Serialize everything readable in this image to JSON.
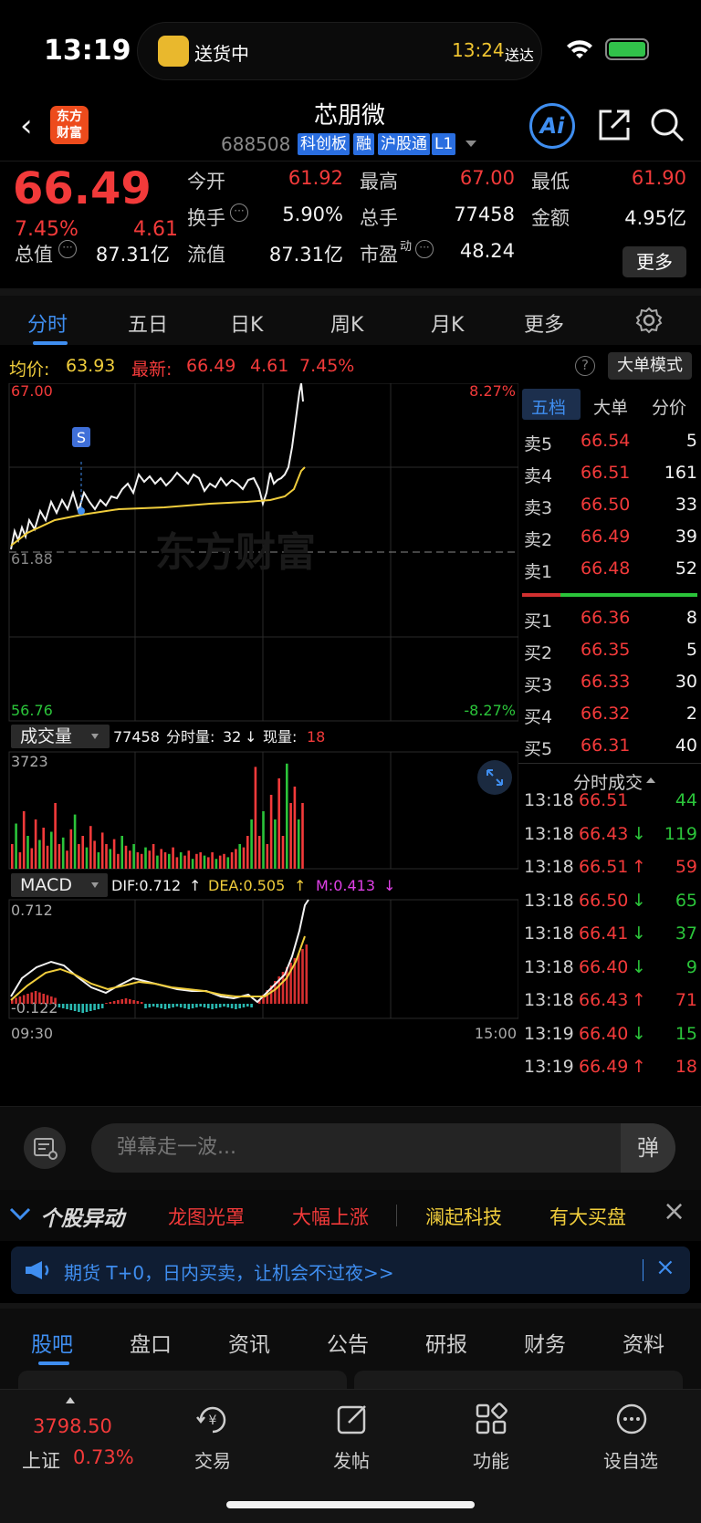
{
  "status": {
    "time": "13:19",
    "activity": "送货中",
    "eta_time": "13:24",
    "eta_label": "送达"
  },
  "header": {
    "back": "‹",
    "logo": "东方\n财富",
    "name": "芯朋微",
    "code": "688508",
    "tags": [
      "科创板",
      "融",
      "沪股通",
      "L1"
    ],
    "ai": "Ai"
  },
  "quote": {
    "price": "66.49",
    "change_pct": "7.45%",
    "change_amt": "4.61",
    "open_label": "今开",
    "open": "61.92",
    "high_label": "最高",
    "high": "67.00",
    "low_label": "最低",
    "low": "61.90",
    "turnover_label": "换手",
    "turnover": "5.90%",
    "volume_label": "总手",
    "volume": "77458",
    "amount_label": "金额",
    "amount": "4.95亿",
    "mcap_label": "总值",
    "mcap": "87.31亿",
    "float_label": "流值",
    "float": "87.31亿",
    "pe_label": "市盈",
    "pe_sup": "动",
    "pe": "48.24",
    "more": "更多"
  },
  "tabs": [
    "分时",
    "五日",
    "日K",
    "周K",
    "月K",
    "更多"
  ],
  "avgbar": {
    "avg_label": "均价:",
    "avg": "63.93",
    "latest_label": "最新:",
    "latest": "66.49",
    "latest_chg": "4.61",
    "latest_pct": "7.45%",
    "help": "?",
    "mode": "大单模式"
  },
  "chart_labels": {
    "top_price": "67.00",
    "top_pct": "8.27%",
    "mid_price": "61.88",
    "bottom_price": "56.76",
    "bottom_pct": "-8.27%",
    "watermark": "东方财富",
    "signal": "S",
    "vol_select": "成交量",
    "vol_total": "77458",
    "vol_min_label": "分时量:",
    "vol_min": "32",
    "vol_now_label": "现量:",
    "vol_now": "18",
    "vol_max": "3723",
    "macd_select": "MACD",
    "dif": "DIF:0.712",
    "dea": "DEA:0.505",
    "m": "M:0.413",
    "macd_top": "0.712",
    "macd_bottom": "-0.122",
    "time_start": "09:30",
    "time_end": "15:00"
  },
  "chart_data": {
    "type": "line",
    "ylim": [
      56.76,
      67.0
    ],
    "series": [],
    "x_start": "09:30",
    "x_end": "15:00"
  },
  "book": {
    "tabs": [
      "五档",
      "大单",
      "分价"
    ],
    "asks": [
      {
        "label": "卖5",
        "price": "66.54",
        "vol": "5"
      },
      {
        "label": "卖4",
        "price": "66.51",
        "vol": "161"
      },
      {
        "label": "卖3",
        "price": "66.50",
        "vol": "33"
      },
      {
        "label": "卖2",
        "price": "66.49",
        "vol": "39"
      },
      {
        "label": "卖1",
        "price": "66.48",
        "vol": "52"
      }
    ],
    "bids": [
      {
        "label": "买1",
        "price": "66.36",
        "vol": "8"
      },
      {
        "label": "买2",
        "price": "66.35",
        "vol": "5"
      },
      {
        "label": "买3",
        "price": "66.33",
        "vol": "30"
      },
      {
        "label": "买4",
        "price": "66.32",
        "vol": "2"
      },
      {
        "label": "买5",
        "price": "66.31",
        "vol": "40"
      }
    ],
    "ticks_title": "分时成交",
    "ticks": [
      {
        "time": "13:18",
        "price": "66.51",
        "arrow": "",
        "vol": "44",
        "color": "green"
      },
      {
        "time": "13:18",
        "price": "66.43",
        "arrow": "↓",
        "vol": "119",
        "color": "green"
      },
      {
        "time": "13:18",
        "price": "66.51",
        "arrow": "↑",
        "vol": "59",
        "color": "red"
      },
      {
        "time": "13:18",
        "price": "66.50",
        "arrow": "↓",
        "vol": "65",
        "color": "green"
      },
      {
        "time": "13:18",
        "price": "66.41",
        "arrow": "↓",
        "vol": "37",
        "color": "green"
      },
      {
        "time": "13:18",
        "price": "66.40",
        "arrow": "↓",
        "vol": "9",
        "color": "green"
      },
      {
        "time": "13:18",
        "price": "66.43",
        "arrow": "↑",
        "vol": "71",
        "color": "red"
      },
      {
        "time": "13:19",
        "price": "66.40",
        "arrow": "↓",
        "vol": "15",
        "color": "green"
      },
      {
        "time": "13:19",
        "price": "66.49",
        "arrow": "↑",
        "vol": "18",
        "color": "red"
      }
    ]
  },
  "comment": {
    "placeholder": "弹幕走一波...",
    "danmu": "弹"
  },
  "movement": {
    "title": "个股异动",
    "items": [
      "龙图光罩",
      "大幅上涨",
      "澜起科技",
      "有大买盘"
    ]
  },
  "notice": {
    "text": "期货 T+0，日内买卖，让机会不过夜>>"
  },
  "subtabs": [
    "股吧",
    "盘口",
    "资讯",
    "公告",
    "研报",
    "财务",
    "资料"
  ],
  "bottomnav": {
    "index_value": "3798.50",
    "index_name": "上证",
    "index_pct": "0.73%",
    "items": [
      "交易",
      "发帖",
      "功能",
      "设自选"
    ]
  },
  "colors": {
    "up": "#f23a3a",
    "down": "#2bc43a",
    "accent": "#3f8ef0",
    "avg_line": "#f0cd3c"
  }
}
